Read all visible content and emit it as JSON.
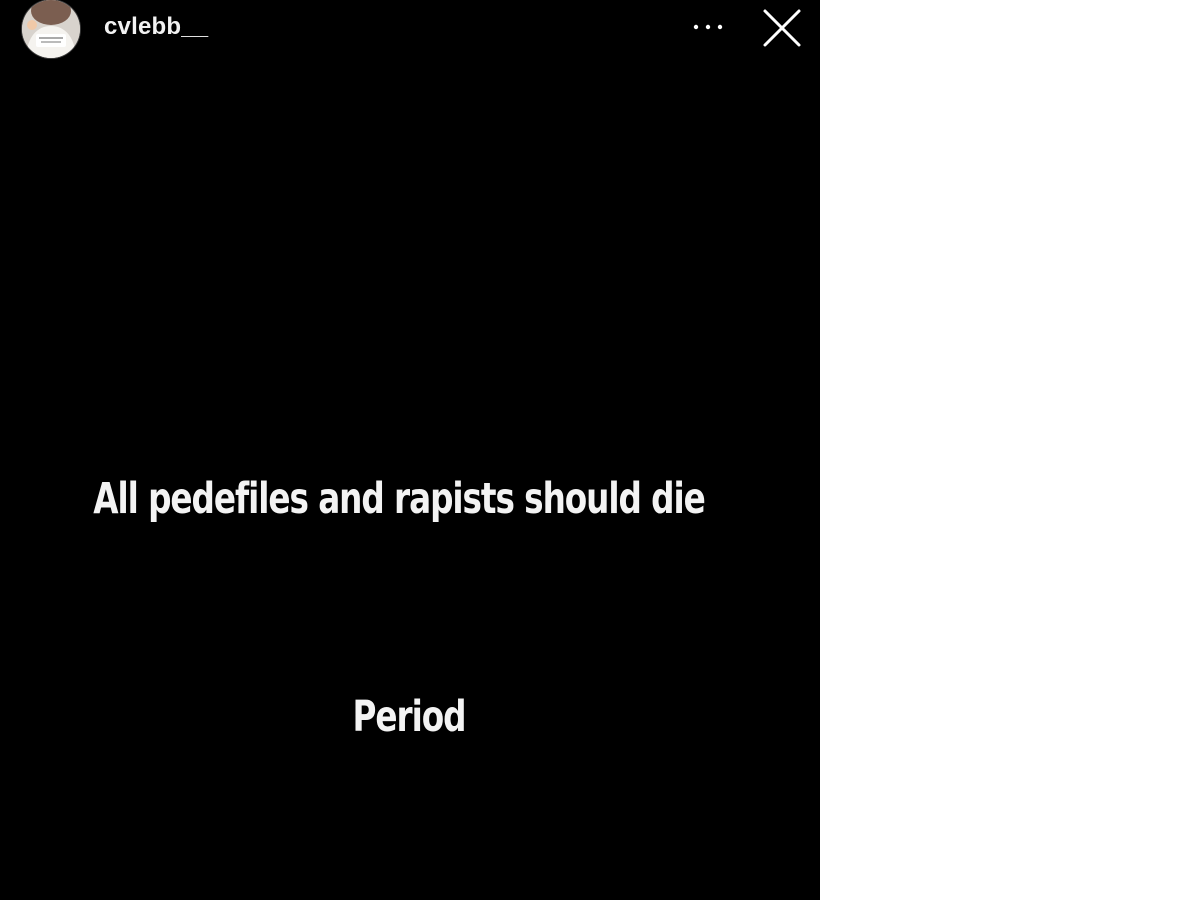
{
  "story": {
    "username": "cvlebb__",
    "lines": [
      "All pedefiles and rapists should die",
      "Period"
    ],
    "icons": {
      "more": "more-horizontal-icon",
      "close": "close-icon"
    },
    "colors": {
      "background": "#000000",
      "text": "#f3f3f3",
      "page": "#ffffff"
    }
  }
}
